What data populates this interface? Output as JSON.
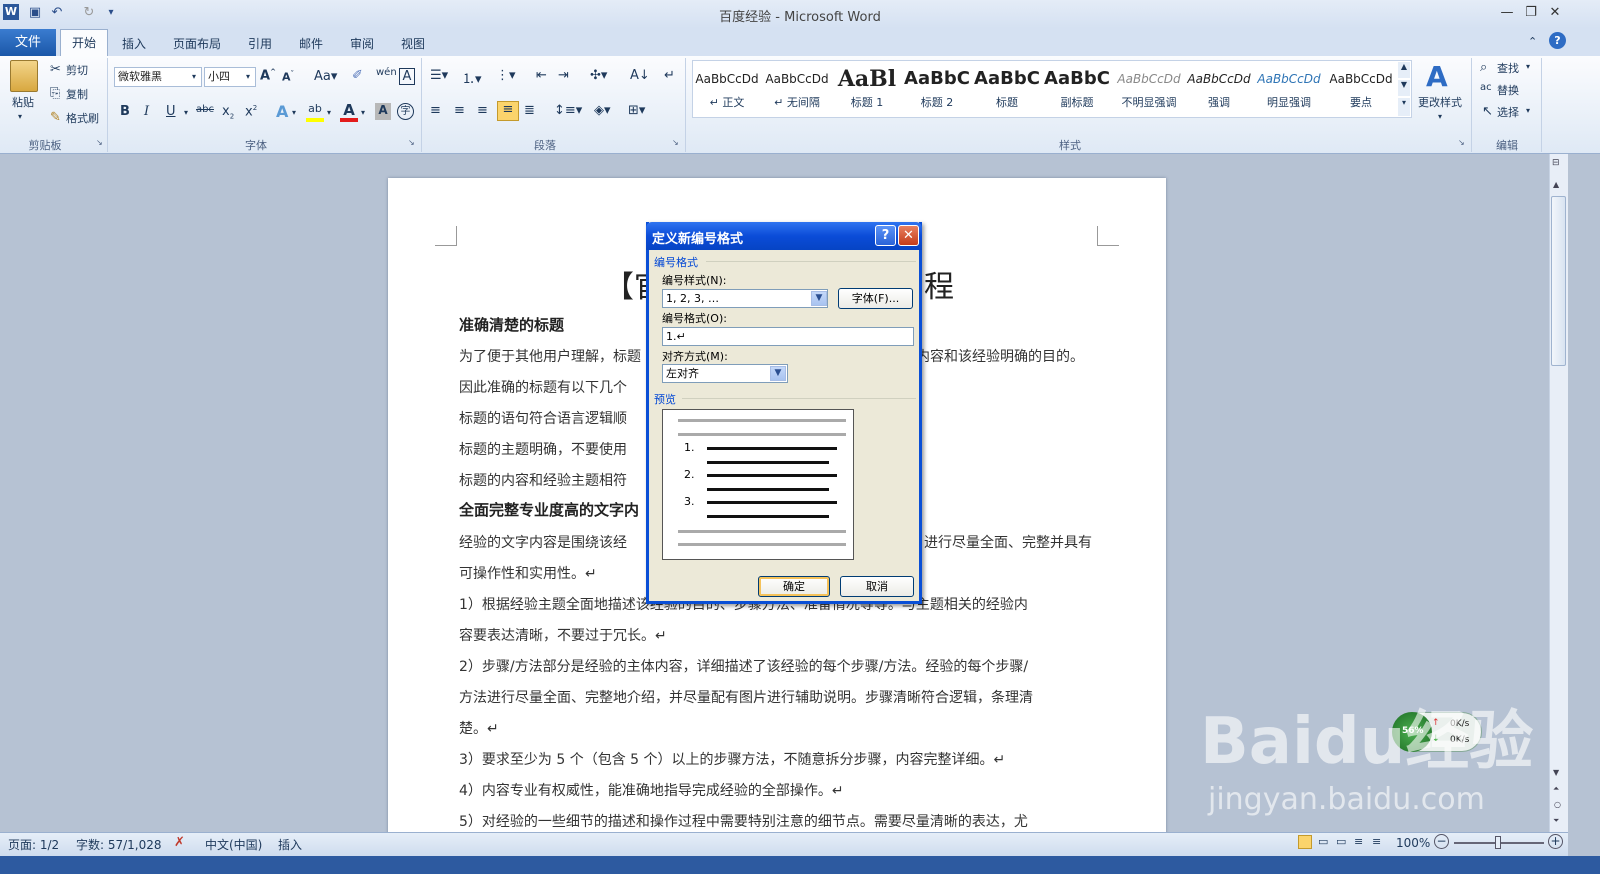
{
  "window": {
    "title": "百度经验 - Microsoft Word"
  },
  "tabs": {
    "file": "文件",
    "home": "开始",
    "insert": "插入",
    "layout": "页面布局",
    "references": "引用",
    "mailings": "邮件",
    "review": "审阅",
    "view": "视图"
  },
  "ribbon": {
    "clipboard": {
      "paste": "粘贴",
      "cut": "剪切",
      "copy": "复制",
      "format_painter": "格式刷",
      "label": "剪贴板"
    },
    "font": {
      "family": "微软雅黑",
      "size": "小四",
      "label": "字体"
    },
    "paragraph": {
      "label": "段落"
    },
    "styles": {
      "label": "样式",
      "items": [
        {
          "sample": "AaBbCcDd",
          "name": "↵ 正文"
        },
        {
          "sample": "AaBbCcDd",
          "name": "↵ 无间隔"
        },
        {
          "sample": "AaBl",
          "name": "标题 1"
        },
        {
          "sample": "AaBbC",
          "name": "标题 2"
        },
        {
          "sample": "AaBbC",
          "name": "标题"
        },
        {
          "sample": "AaBbC",
          "name": "副标题"
        },
        {
          "sample": "AaBbCcDd",
          "name": "不明显强调"
        },
        {
          "sample": "AaBbCcDd",
          "name": "强调"
        },
        {
          "sample": "AaBbCcDd",
          "name": "明显强调"
        },
        {
          "sample": "AaBbCcDd",
          "name": "要点"
        }
      ],
      "change_styles": "更改样式"
    },
    "editing": {
      "find": "查找",
      "replace": "替换",
      "select": "选择",
      "label": "编辑"
    }
  },
  "document": {
    "title_left": "【官",
    "title_right": "程",
    "heading1": "准确清楚的标题",
    "p1": "为了便于其他用户理解，标题",
    "p1_right": "内容和该经验明确的目的。",
    "p2": "因此准确的标题有以下几个",
    "p3": "标题的语句符合语言逻辑顺",
    "p4": "标题的主题明确，不要使用",
    "p5": "标题的内容和经验主题相符",
    "heading2": "全面完整专业度高的文字内",
    "p6": "经验的文字内容是围绕该经",
    "p6_right": "进行尽量全面、完整并具有",
    "p7": "可操作性和实用性。↵",
    "p8": "1）根据经验主题全面地描述该经验的目的、步骤方法、准备情况等等。与主题相关的经验内",
    "p9": "容要表达清晰，不要过于冗长。↵",
    "p10": "2）步骤/方法部分是经验的主体内容，详细描述了该经验的每个步骤/方法。经验的每个步骤/",
    "p11": "方法进行尽量全面、完整地介绍，并尽量配有图片进行辅助说明。步骤清晰符合逻辑，条理清",
    "p12": "楚。↵",
    "p13": "3）要求至少为 5 个（包含 5 个）以上的步骤方法，不随意拆分步骤，内容完整详细。↵",
    "p14": "4）内容专业有权威性，能准确地指导完成经验的全部操作。↵",
    "p15": "5）对经验的一些细节的描述和操作过程中需要特别注意的细节点。需要尽量清晰的表达，尤"
  },
  "dialog": {
    "title": "定义新编号格式",
    "section_format": "编号格式",
    "style_label": "编号样式(N):",
    "style_value": "1, 2, 3, …",
    "font_button": "字体(F)...",
    "format_label": "编号格式(O):",
    "format_value": "1.↵",
    "align_label": "对齐方式(M):",
    "align_value": "左对齐",
    "section_preview": "预览",
    "preview_numbers": [
      "1.",
      "2.",
      "3."
    ],
    "ok": "确定",
    "cancel": "取消"
  },
  "status": {
    "page": "页面: 1/2",
    "words": "字数: 57/1,028",
    "lang": "中文(中国)",
    "mode": "插入",
    "zoom": "100%"
  },
  "watermark": {
    "brand": "Baidu经验",
    "url": "jingyan.baidu.com"
  },
  "speed": {
    "up": "0K/s",
    "down": "0K/s",
    "ball": "56%"
  }
}
